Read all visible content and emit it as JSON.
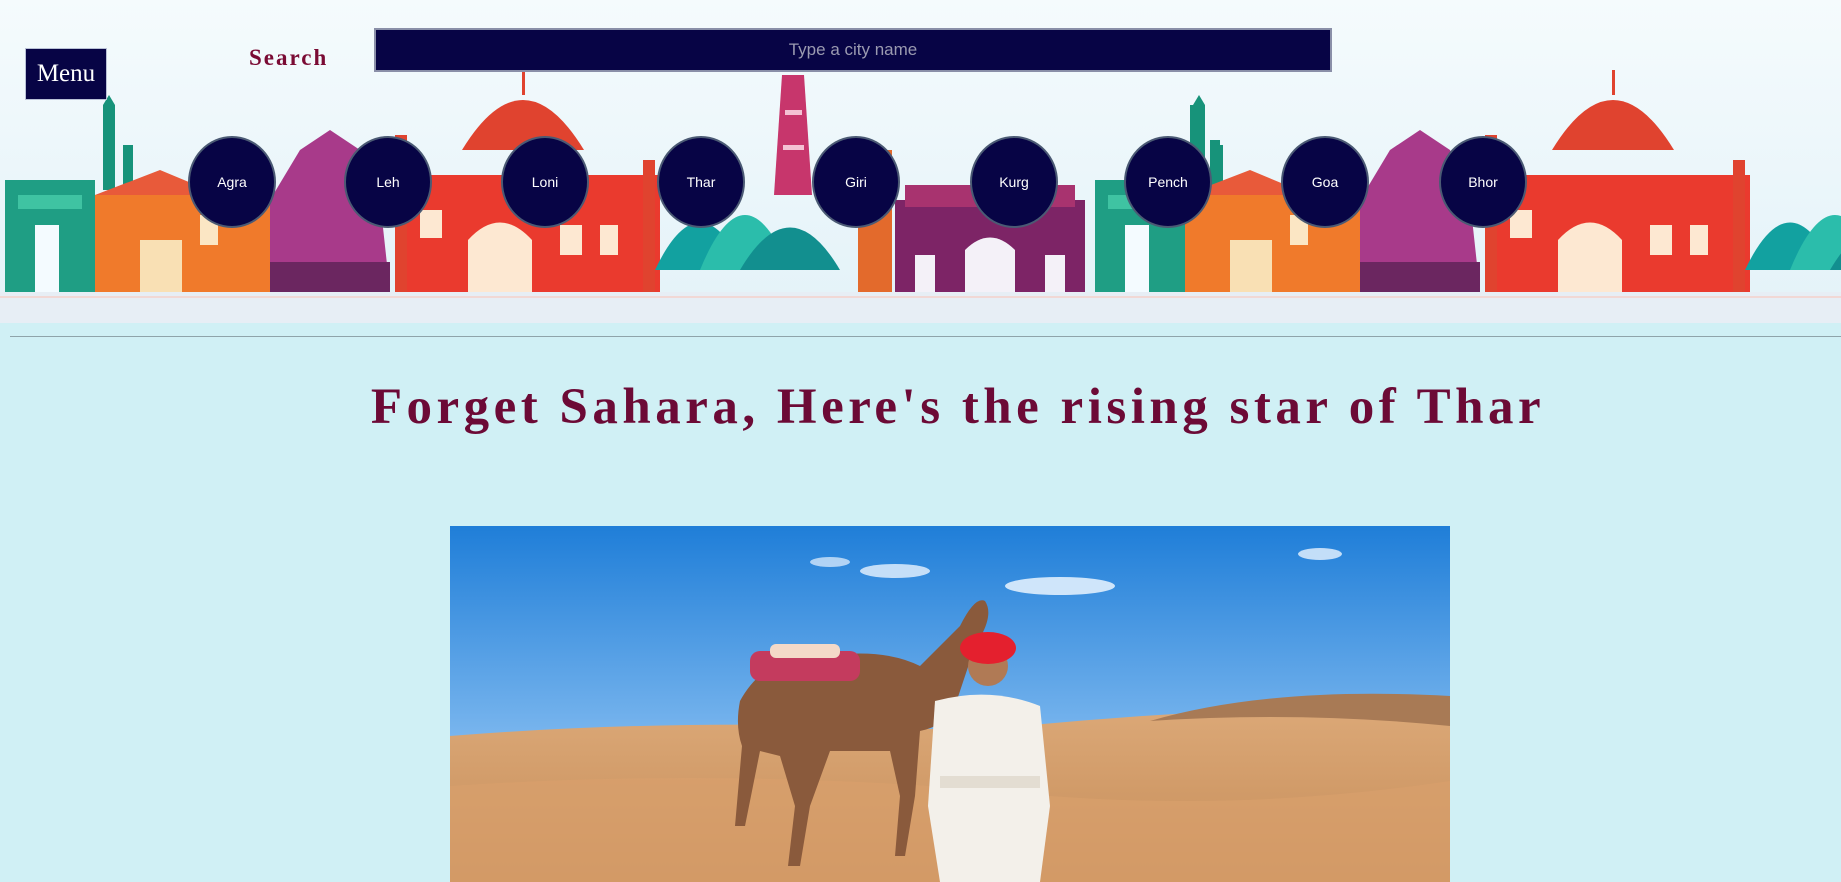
{
  "header": {
    "menu_label": "Menu",
    "search_label": "Search",
    "search_placeholder": "Type a city name"
  },
  "cities": [
    "Agra",
    "Leh",
    "Loni",
    "Thar",
    "Giri",
    "Kurg",
    "Pench",
    "Goa",
    "Bhor"
  ],
  "article": {
    "headline": "Forget Sahara, Here's the rising star of Thar"
  },
  "colors": {
    "page_background": "#d0f0f5",
    "navy": "#070445",
    "headline": "#6c0a36"
  },
  "icons": {
    "skyline": "india-monuments-skyline-illustration",
    "photo": "camel-and-man-in-thar-desert"
  }
}
